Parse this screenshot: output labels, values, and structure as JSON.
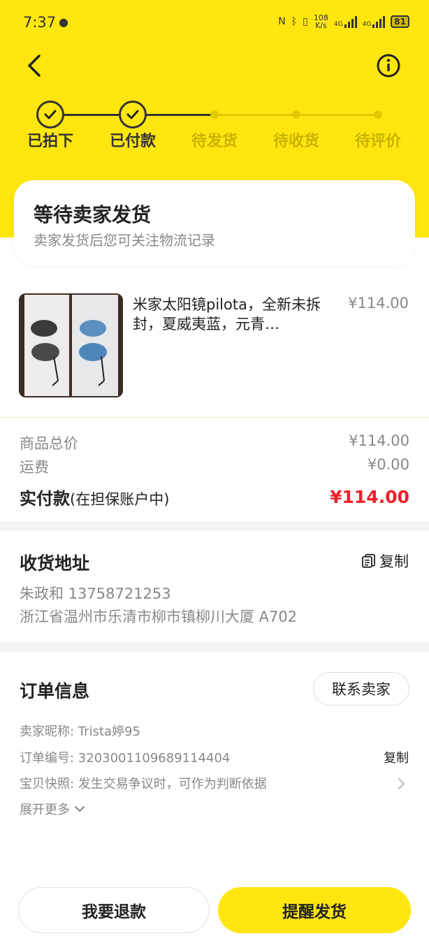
{
  "status_bar": {
    "time": "7:37",
    "left_icons": [
      "leaf-icon",
      "text-icon"
    ],
    "speed_value": "108",
    "speed_unit": "K/s",
    "network_1": "4G",
    "network_2": "4G",
    "battery": "81"
  },
  "header": {
    "back_icon": "chevron-left-icon",
    "info_icon": "info-circle-icon"
  },
  "steps": [
    {
      "label": "已拍下",
      "state": "done"
    },
    {
      "label": "已付款",
      "state": "done"
    },
    {
      "label": "待发货",
      "state": "todo"
    },
    {
      "label": "待收货",
      "state": "todo"
    },
    {
      "label": "待评价",
      "state": "todo"
    }
  ],
  "status_card": {
    "title": "等待卖家发货",
    "subtitle": "卖家发货后您可关注物流记录"
  },
  "product": {
    "title": "米家太阳镜pilota，全新未拆封，夏威夷蓝，元青…",
    "price": "¥114.00"
  },
  "price_summary": {
    "goods_label": "商品总价",
    "goods_value": "¥114.00",
    "shipping_label": "运费",
    "shipping_value": "¥0.00",
    "paid_label": "实付款",
    "paid_note": "(在担保账户中)",
    "paid_value": "¥114.00"
  },
  "address": {
    "title": "收货地址",
    "copy_label": "复制",
    "name_phone": "朱政和 13758721253",
    "detail": "浙江省温州市乐清市柳市镇柳川大厦 A702"
  },
  "order_info": {
    "title": "订单信息",
    "contact_label": "联系卖家",
    "seller_line": "卖家昵称: Trista婷95",
    "order_no_line": "订单编号: 3203001109689114404",
    "copy_label": "复制",
    "snapshot_line": "宝贝快照: 发生交易争议时，可作为判断依据",
    "expand_label": "展开更多"
  },
  "actions": {
    "refund_label": "我要退款",
    "remind_label": "提醒发货"
  },
  "colors": {
    "brand_yellow": "#FFE60F",
    "price_red": "#F0202A"
  }
}
